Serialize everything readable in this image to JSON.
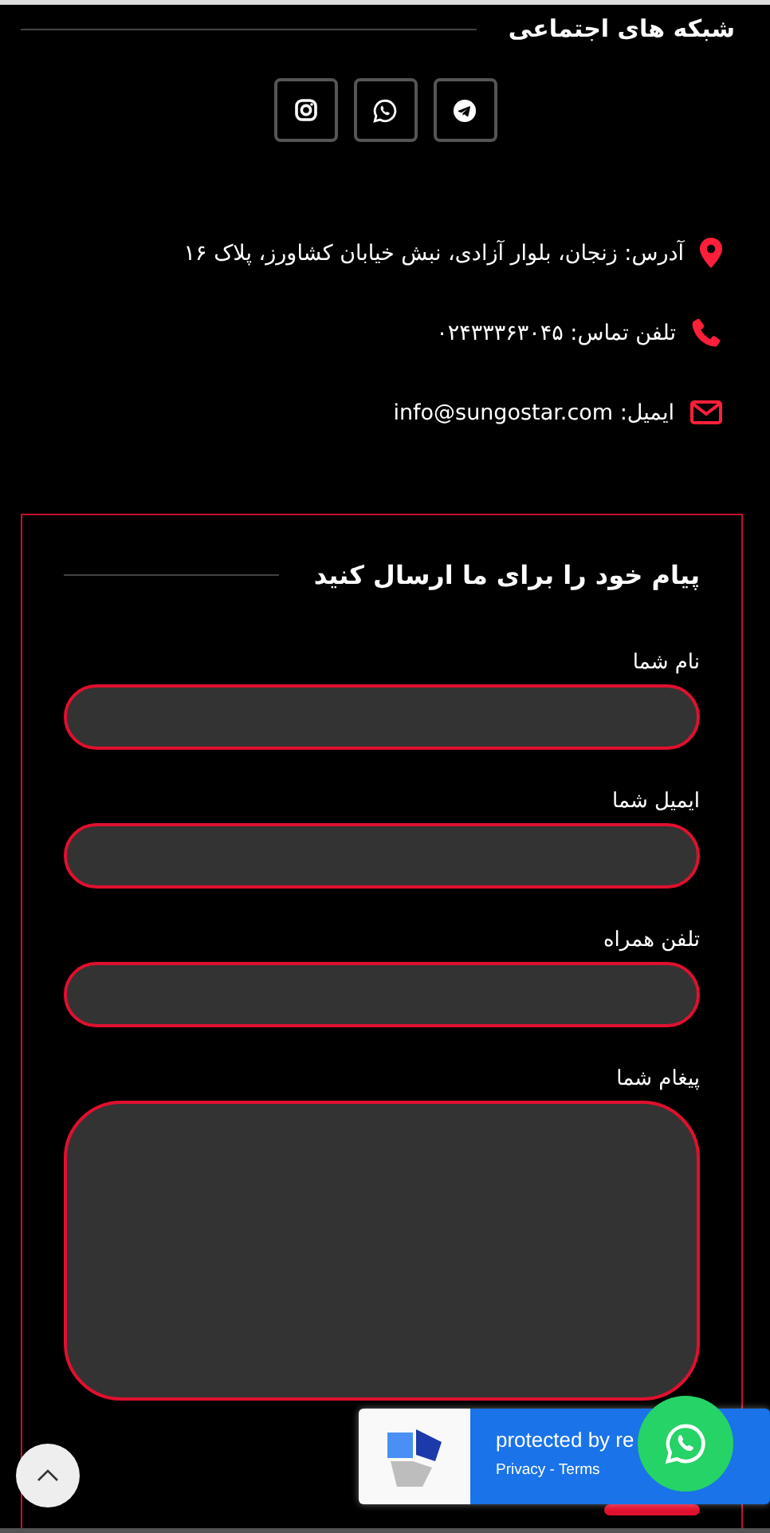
{
  "social": {
    "title": "شبکه های اجتماعی",
    "buttons": [
      {
        "kind": "instagram"
      },
      {
        "kind": "whatsapp"
      },
      {
        "kind": "telegram"
      }
    ]
  },
  "contacts": [
    {
      "kind": "address",
      "text": "آدرس: زنجان، بلوار آزادی، نبش خیابان کشاورز، پلاک ۱۶"
    },
    {
      "kind": "phone",
      "text": "تلفن تماس: ۰۲۴۳۳۳۶۳۰۴۵"
    },
    {
      "kind": "email",
      "text": "ایمیل: info@sungostar.com"
    }
  ],
  "form": {
    "title": "پیام خود را برای ما ارسال کنید",
    "fields": [
      {
        "label": "نام شما",
        "kind": "input"
      },
      {
        "label": "ایمیل شما",
        "kind": "input"
      },
      {
        "label": "تلفن همراه",
        "kind": "input"
      },
      {
        "label": "پیغام شما",
        "kind": "textarea"
      }
    ]
  },
  "recaptcha": {
    "text": "protected by re",
    "links": "Privacy - Terms"
  }
}
